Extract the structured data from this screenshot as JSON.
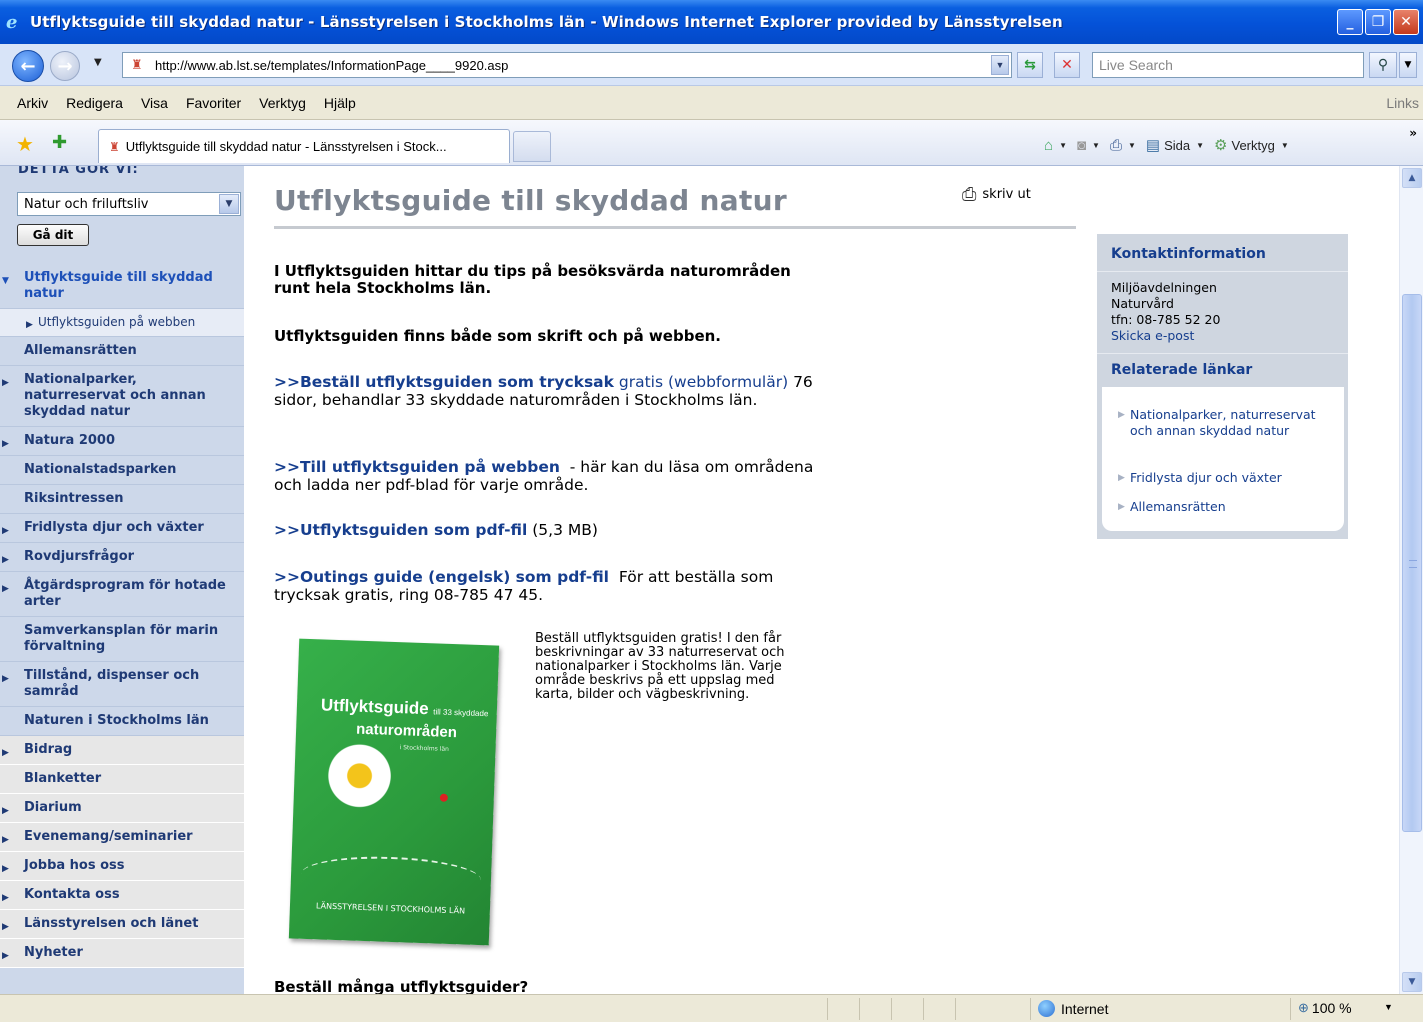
{
  "window": {
    "title": "Utflyktsguide till skyddad natur - Länsstyrelsen i Stockholms län - Windows Internet Explorer provided by Länsstyrelsen",
    "min": "_",
    "max": "❐",
    "close": "✕"
  },
  "address": {
    "url": "http://www.ab.lst.se/templates/InformationPage____9920.asp",
    "search_placeholder": "Live Search"
  },
  "menu": {
    "items": [
      "Arkiv",
      "Redigera",
      "Visa",
      "Favoriter",
      "Verktyg",
      "Hjälp"
    ],
    "links": "Links"
  },
  "tabs": {
    "active": "Utflyktsguide till skyddad natur - Länsstyrelsen i Stock...",
    "sida": "Sida",
    "verktyg": "Verktyg",
    "more": "»"
  },
  "sidebar": {
    "heading": "DETTA GÖR VI:",
    "select_value": "Natur och friluftsliv",
    "go_label": "Gå dit",
    "items": [
      {
        "label": "Utflyktsguide till skyddad natur",
        "marker": "▼"
      },
      {
        "label": "Utflyktsguiden på webben",
        "marker": "▶"
      },
      {
        "label": "Allemansrätten",
        "marker": ""
      },
      {
        "label": "Nationalparker, naturreservat och annan skyddad natur",
        "marker": "▶"
      },
      {
        "label": "Natura 2000",
        "marker": "▶"
      },
      {
        "label": "Nationalstadsparken",
        "marker": ""
      },
      {
        "label": "Riksintressen",
        "marker": ""
      },
      {
        "label": "Fridlysta djur och växter",
        "marker": "▶"
      },
      {
        "label": "Rovdjursfrågor",
        "marker": "▶"
      },
      {
        "label": "Åtgärdsprogram för hotade arter",
        "marker": "▶"
      },
      {
        "label": "Samverkansplan för marin förvaltning",
        "marker": ""
      },
      {
        "label": "Tillstånd, dispenser och samråd",
        "marker": "▶"
      },
      {
        "label": "Naturen i Stockholms län",
        "marker": ""
      },
      {
        "label": "Bidrag",
        "marker": "▶"
      },
      {
        "label": "Blanketter",
        "marker": ""
      },
      {
        "label": "Diarium",
        "marker": "▶"
      },
      {
        "label": "Evenemang/seminarier",
        "marker": "▶"
      },
      {
        "label": "Jobba hos oss",
        "marker": "▶"
      },
      {
        "label": "Kontakta oss",
        "marker": "▶"
      },
      {
        "label": "Länsstyrelsen och länet",
        "marker": "▶"
      },
      {
        "label": "Nyheter",
        "marker": "▶"
      }
    ]
  },
  "main": {
    "title": "Utflyktsguide till skyddad natur",
    "print": "skriv ut",
    "intro": "I Utflyktsguiden hittar du tips på besöksvärda naturområden runt hela Stockholms län.",
    "intro2": "Utflyktsguiden finns både som skrift och på webben.",
    "p1_link": ">>Beställ utflyktsguiden som trycksak",
    "p1_link2": "gratis (webbformulär)",
    "p1_text": "76 sidor, behandlar 33 skyddade naturområden i Stockholms län.",
    "p2_link": ">>Till utflyktsguiden på webben",
    "p2_text": "- här kan du läsa om områdena och ladda ner pdf-blad för varje område.",
    "p3_link": ">>Utflyktsguiden som pdf-fil",
    "p3_text": "(5,3 MB)",
    "p4_link": ">>Outings guide (engelsk) som pdf-fil",
    "p4_text": "För att beställa som trycksak gratis, ring 08-785 47 45.",
    "caption": "Beställ utflyktsguiden gratis! I den får beskrivningar av 33 naturreservat och nationalparker i Stockholms län. Varje område beskrivs på ett uppslag med karta, bilder och vägbeskrivning.",
    "more": "Beställ många utflyktsguider?",
    "cover": {
      "title": "Utflyktsguide",
      "title_small": "till 33 skyddade",
      "title2": "naturområden",
      "sub": "i Stockholms län",
      "publisher": "LÄNSSTYRELSEN I STOCKHOLMS LÄN"
    }
  },
  "contact": {
    "heading": "Kontaktinformation",
    "dept": "Miljöavdelningen",
    "unit": "Naturvård",
    "phone": "tfn: 08-785 52 20",
    "email_link": "Skicka e-post",
    "related_heading": "Relaterade länkar",
    "related": [
      "Nationalparker, naturreservat och annan skyddad natur",
      "Fridlysta djur och växter",
      "Allemansrätten"
    ]
  },
  "status": {
    "zone": "Internet",
    "zoom": "100 %"
  }
}
